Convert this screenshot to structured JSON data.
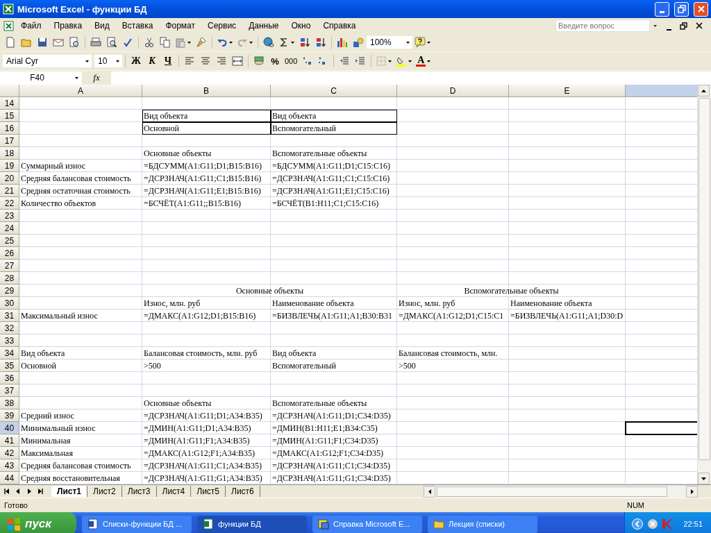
{
  "window": {
    "title": "Microsoft Excel - функции БД"
  },
  "menu": [
    "Файл",
    "Правка",
    "Вид",
    "Вставка",
    "Формат",
    "Сервис",
    "Данные",
    "Окно",
    "Справка"
  ],
  "help_box": {
    "placeholder": "Введите вопрос"
  },
  "standard_toolbar": {
    "zoom": "100%"
  },
  "formatting_toolbar": {
    "font": "Arial Cyr",
    "size": "10",
    "bold": "Ж",
    "italic": "К",
    "underline": "Ч",
    "percent": "%",
    "thousands": "000",
    "font_color": "A"
  },
  "formula_bar": {
    "name_box": "F40",
    "function_label": "fx"
  },
  "columns": [
    {
      "letter": "A",
      "selected": false
    },
    {
      "letter": "B",
      "selected": false
    },
    {
      "letter": "C",
      "selected": false
    },
    {
      "letter": "D",
      "selected": false
    },
    {
      "letter": "E",
      "selected": false
    },
    {
      "selected": true
    }
  ],
  "rows": [
    {
      "number": "14",
      "selected": false
    },
    {
      "number": "15",
      "selected": false,
      "cells": [
        null,
        {
          "text": "Вид объекта",
          "boxed": true
        },
        {
          "text": "Вид объекта",
          "boxed": true
        }
      ]
    },
    {
      "number": "16",
      "selected": false,
      "cells": [
        null,
        {
          "text": "Основной",
          "boxed": true
        },
        {
          "text": "Вспомогательный",
          "boxed": true
        }
      ]
    },
    {
      "number": "17",
      "selected": false
    },
    {
      "number": "18",
      "selected": false,
      "cells": [
        null,
        {
          "text": "Основные объекты"
        },
        {
          "text": "Вспомогательные объекты"
        }
      ]
    },
    {
      "number": "19",
      "selected": false,
      "cells": [
        {
          "text": "Суммарный износ"
        },
        {
          "text": "=БДСУММ(A1:G11;D1;B15:B16)"
        },
        {
          "text": "=БДСУММ(A1:G11;D1;C15:C16)"
        }
      ]
    },
    {
      "number": "20",
      "selected": false,
      "cells": [
        {
          "text": "Средняя балансовая стоимость"
        },
        {
          "text": "=ДСРЗНАЧ(A1:G11;C1;B15:B16)"
        },
        {
          "text": "=ДСРЗНАЧ(A1:G11;C1;C15:C16)"
        }
      ]
    },
    {
      "number": "21",
      "selected": false,
      "cells": [
        {
          "text": "Средняя остаточная стоимость"
        },
        {
          "text": "=ДСРЗНАЧ(A1:G11;E1;B15:B16)"
        },
        {
          "text": "=ДСРЗНАЧ(A1:G11;E1;C15:C16)"
        }
      ]
    },
    {
      "number": "22",
      "selected": false,
      "cells": [
        {
          "text": "Количество объектов"
        },
        {
          "text": "=БСЧЁТ(A1:G11;;B15:B16)"
        },
        {
          "text": "=БСЧЁТ(B1:H11;C1;C15:C16)"
        }
      ]
    },
    {
      "number": "23",
      "selected": false
    },
    {
      "number": "24",
      "selected": false
    },
    {
      "number": "25",
      "selected": false
    },
    {
      "number": "26",
      "selected": false
    },
    {
      "number": "27",
      "selected": false
    },
    {
      "number": "28",
      "selected": false
    },
    {
      "number": "29",
      "selected": false,
      "cells": [
        null,
        {
          "text": "Основные объекты",
          "centered_across": true
        },
        null,
        {
          "text": "Вспомогательные объекты",
          "centered_across": true
        }
      ]
    },
    {
      "number": "30",
      "selected": false,
      "cells": [
        null,
        {
          "text": "Износ, млн. руб"
        },
        {
          "text": "Наименование объекта"
        },
        {
          "text": "Износ, млн. руб"
        },
        {
          "text": "Наименование объекта"
        }
      ]
    },
    {
      "number": "31",
      "selected": false,
      "cells": [
        {
          "text": "Максимальный износ"
        },
        {
          "text": "=ДМАКС(A1:G12;D1;B15:B16)"
        },
        {
          "text": "=БИЗВЛЕЧЬ(A1:G11;A1;B30:B31"
        },
        {
          "text": "=ДМАКС(A1:G12;D1;C15:C1"
        },
        {
          "text": "=БИЗВЛЕЧЬ(A1:G11;A1;D30:D"
        }
      ]
    },
    {
      "number": "32",
      "selected": false
    },
    {
      "number": "33",
      "selected": false
    },
    {
      "number": "34",
      "selected": false,
      "cells": [
        {
          "text": "Вид объекта"
        },
        {
          "text": "Балансовая стоимость, млн. руб"
        },
        {
          "text": "Вид объекта"
        },
        {
          "text": "Балансовая стоимость, млн."
        }
      ]
    },
    {
      "number": "35",
      "selected": false,
      "cells": [
        {
          "text": "Основной"
        },
        {
          "text": ">500"
        },
        {
          "text": "Вспомогательный"
        },
        {
          "text": ">500"
        }
      ]
    },
    {
      "number": "36",
      "selected": false
    },
    {
      "number": "37",
      "selected": false
    },
    {
      "number": "38",
      "selected": false,
      "cells": [
        null,
        {
          "text": "Основные объекты"
        },
        {
          "text": "Вспомогательные объекты"
        }
      ]
    },
    {
      "number": "39",
      "selected": false,
      "cells": [
        {
          "text": "Средний износ"
        },
        {
          "text": "=ДСРЗНАЧ(A1:G11;D1;A34:B35)"
        },
        {
          "text": "=ДСРЗНАЧ(A1:G11;D1;C34:D35)"
        }
      ]
    },
    {
      "number": "40",
      "selected": true,
      "cells": [
        {
          "text": "Минимальный износ"
        },
        {
          "text": "=ДМИН(A1:G11;D1;A34:B35)"
        },
        {
          "text": "=ДМИН(B1:H11;E1;B34:C35)"
        }
      ]
    },
    {
      "number": "41",
      "selected": false,
      "cells": [
        {
          "text": "Минимальная"
        },
        {
          "text": "=ДМИН(A1:G11;F1;A34:B35)"
        },
        {
          "text": "=ДМИН(A1:G11;F1;C34:D35)"
        }
      ]
    },
    {
      "number": "42",
      "selected": false,
      "cells": [
        {
          "text": "Максимальная"
        },
        {
          "text": "=ДМАКС(A1:G12;F1;A34:B35)"
        },
        {
          "text": "=ДМАКС(A1:G12;F1;C34:D35)"
        }
      ]
    },
    {
      "number": "43",
      "selected": false,
      "cells": [
        {
          "text": "Средняя балансовая стоимость"
        },
        {
          "text": "=ДСРЗНАЧ(A1:G11;C1;A34:B35)"
        },
        {
          "text": "=ДСРЗНАЧ(A1:G11;C1;C34:D35)"
        }
      ]
    },
    {
      "number": "44",
      "selected": false,
      "cells": [
        {
          "text": "Средняя восстановительная"
        },
        {
          "text": "=ДСРЗНАЧ(A1:G11;G1;A34:B35)"
        },
        {
          "text": "=ДСРЗНАЧ(A1:G11;G1;C34:D35)"
        }
      ]
    }
  ],
  "sheet_tabs": [
    {
      "label": "Лист1",
      "selected": true
    },
    {
      "label": "Лист2",
      "selected": false
    },
    {
      "label": "Лист3",
      "selected": false
    },
    {
      "label": "Лист4",
      "selected": false
    },
    {
      "label": "Лист5",
      "selected": false
    },
    {
      "label": "Лист6",
      "selected": false
    }
  ],
  "status_bar": {
    "text": "Готово",
    "indicator": "NUM"
  },
  "taskbar": {
    "start": "пуск",
    "tasks": [
      {
        "label": "Списки-функции БД ...",
        "selected": false,
        "kind": "word"
      },
      {
        "label": "функции БД",
        "selected": true,
        "kind": "excel"
      },
      {
        "label": "Справка Microsoft E...",
        "selected": false,
        "kind": "help"
      },
      {
        "label": "Лекция (списки)",
        "selected": false,
        "kind": "folder"
      }
    ],
    "clock": "22:51"
  }
}
